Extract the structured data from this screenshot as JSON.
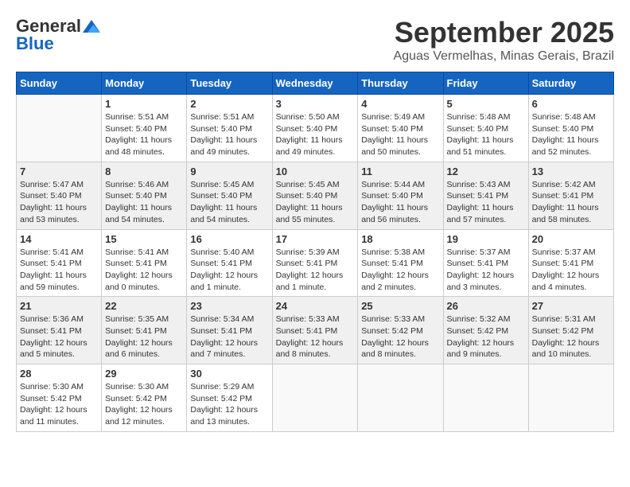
{
  "header": {
    "logo_line1": "General",
    "logo_line2": "Blue",
    "month_title": "September 2025",
    "location": "Aguas Vermelhas, Minas Gerais, Brazil"
  },
  "calendar": {
    "days_of_week": [
      "Sunday",
      "Monday",
      "Tuesday",
      "Wednesday",
      "Thursday",
      "Friday",
      "Saturday"
    ],
    "weeks": [
      [
        {
          "day": "",
          "info": ""
        },
        {
          "day": "1",
          "info": "Sunrise: 5:51 AM\nSunset: 5:40 PM\nDaylight: 11 hours\nand 48 minutes."
        },
        {
          "day": "2",
          "info": "Sunrise: 5:51 AM\nSunset: 5:40 PM\nDaylight: 11 hours\nand 49 minutes."
        },
        {
          "day": "3",
          "info": "Sunrise: 5:50 AM\nSunset: 5:40 PM\nDaylight: 11 hours\nand 49 minutes."
        },
        {
          "day": "4",
          "info": "Sunrise: 5:49 AM\nSunset: 5:40 PM\nDaylight: 11 hours\nand 50 minutes."
        },
        {
          "day": "5",
          "info": "Sunrise: 5:48 AM\nSunset: 5:40 PM\nDaylight: 11 hours\nand 51 minutes."
        },
        {
          "day": "6",
          "info": "Sunrise: 5:48 AM\nSunset: 5:40 PM\nDaylight: 11 hours\nand 52 minutes."
        }
      ],
      [
        {
          "day": "7",
          "info": "Sunrise: 5:47 AM\nSunset: 5:40 PM\nDaylight: 11 hours\nand 53 minutes."
        },
        {
          "day": "8",
          "info": "Sunrise: 5:46 AM\nSunset: 5:40 PM\nDaylight: 11 hours\nand 54 minutes."
        },
        {
          "day": "9",
          "info": "Sunrise: 5:45 AM\nSunset: 5:40 PM\nDaylight: 11 hours\nand 54 minutes."
        },
        {
          "day": "10",
          "info": "Sunrise: 5:45 AM\nSunset: 5:40 PM\nDaylight: 11 hours\nand 55 minutes."
        },
        {
          "day": "11",
          "info": "Sunrise: 5:44 AM\nSunset: 5:40 PM\nDaylight: 11 hours\nand 56 minutes."
        },
        {
          "day": "12",
          "info": "Sunrise: 5:43 AM\nSunset: 5:41 PM\nDaylight: 11 hours\nand 57 minutes."
        },
        {
          "day": "13",
          "info": "Sunrise: 5:42 AM\nSunset: 5:41 PM\nDaylight: 11 hours\nand 58 minutes."
        }
      ],
      [
        {
          "day": "14",
          "info": "Sunrise: 5:41 AM\nSunset: 5:41 PM\nDaylight: 11 hours\nand 59 minutes."
        },
        {
          "day": "15",
          "info": "Sunrise: 5:41 AM\nSunset: 5:41 PM\nDaylight: 12 hours\nand 0 minutes."
        },
        {
          "day": "16",
          "info": "Sunrise: 5:40 AM\nSunset: 5:41 PM\nDaylight: 12 hours\nand 1 minute."
        },
        {
          "day": "17",
          "info": "Sunrise: 5:39 AM\nSunset: 5:41 PM\nDaylight: 12 hours\nand 1 minute."
        },
        {
          "day": "18",
          "info": "Sunrise: 5:38 AM\nSunset: 5:41 PM\nDaylight: 12 hours\nand 2 minutes."
        },
        {
          "day": "19",
          "info": "Sunrise: 5:37 AM\nSunset: 5:41 PM\nDaylight: 12 hours\nand 3 minutes."
        },
        {
          "day": "20",
          "info": "Sunrise: 5:37 AM\nSunset: 5:41 PM\nDaylight: 12 hours\nand 4 minutes."
        }
      ],
      [
        {
          "day": "21",
          "info": "Sunrise: 5:36 AM\nSunset: 5:41 PM\nDaylight: 12 hours\nand 5 minutes."
        },
        {
          "day": "22",
          "info": "Sunrise: 5:35 AM\nSunset: 5:41 PM\nDaylight: 12 hours\nand 6 minutes."
        },
        {
          "day": "23",
          "info": "Sunrise: 5:34 AM\nSunset: 5:41 PM\nDaylight: 12 hours\nand 7 minutes."
        },
        {
          "day": "24",
          "info": "Sunrise: 5:33 AM\nSunset: 5:41 PM\nDaylight: 12 hours\nand 8 minutes."
        },
        {
          "day": "25",
          "info": "Sunrise: 5:33 AM\nSunset: 5:42 PM\nDaylight: 12 hours\nand 8 minutes."
        },
        {
          "day": "26",
          "info": "Sunrise: 5:32 AM\nSunset: 5:42 PM\nDaylight: 12 hours\nand 9 minutes."
        },
        {
          "day": "27",
          "info": "Sunrise: 5:31 AM\nSunset: 5:42 PM\nDaylight: 12 hours\nand 10 minutes."
        }
      ],
      [
        {
          "day": "28",
          "info": "Sunrise: 5:30 AM\nSunset: 5:42 PM\nDaylight: 12 hours\nand 11 minutes."
        },
        {
          "day": "29",
          "info": "Sunrise: 5:30 AM\nSunset: 5:42 PM\nDaylight: 12 hours\nand 12 minutes."
        },
        {
          "day": "30",
          "info": "Sunrise: 5:29 AM\nSunset: 5:42 PM\nDaylight: 12 hours\nand 13 minutes."
        },
        {
          "day": "",
          "info": ""
        },
        {
          "day": "",
          "info": ""
        },
        {
          "day": "",
          "info": ""
        },
        {
          "day": "",
          "info": ""
        }
      ]
    ]
  }
}
